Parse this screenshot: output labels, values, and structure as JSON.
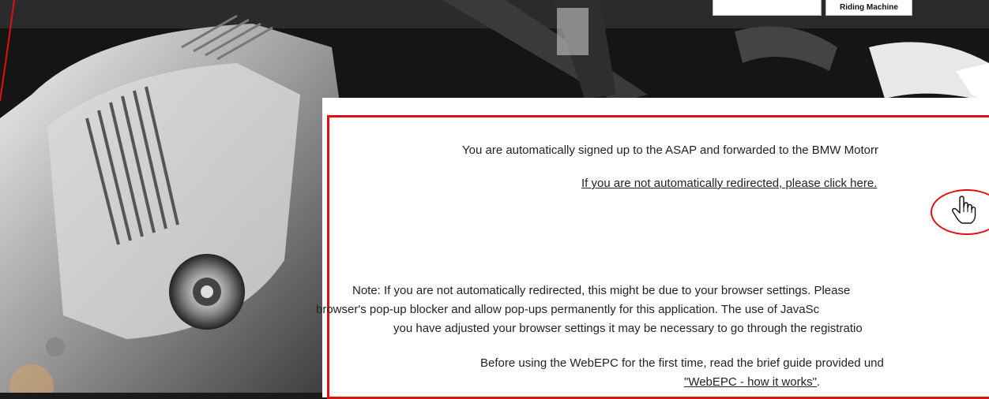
{
  "nav": {
    "item1_label": "",
    "item2_label": "Riding Machine"
  },
  "panel": {
    "signup_text": "You are automatically signed up to the ASAP and forwarded to the BMW Motorr",
    "redirect_link": "If you are not automatically redirected, please click here.",
    "note_line1": "Note: If you are not automatically redirected, this might be due to your browser settings. Please",
    "note_line2": "browser's pop-up blocker and allow pop-ups permanently for this application. The use of JavaSc",
    "note_line3": "you have adjusted your browser settings it may be necessary to go through the registratio",
    "guide_line1": "Before using the WebEPC for the first time, read the brief guide provided und",
    "guide_link": "\"WebEPC - how it works\""
  },
  "guide_suffix": ".",
  "colors": {
    "annotation_red": "#e01010",
    "panel_bg": "#ffffff"
  },
  "icons": {
    "cursor": "hand-pointer-icon"
  }
}
